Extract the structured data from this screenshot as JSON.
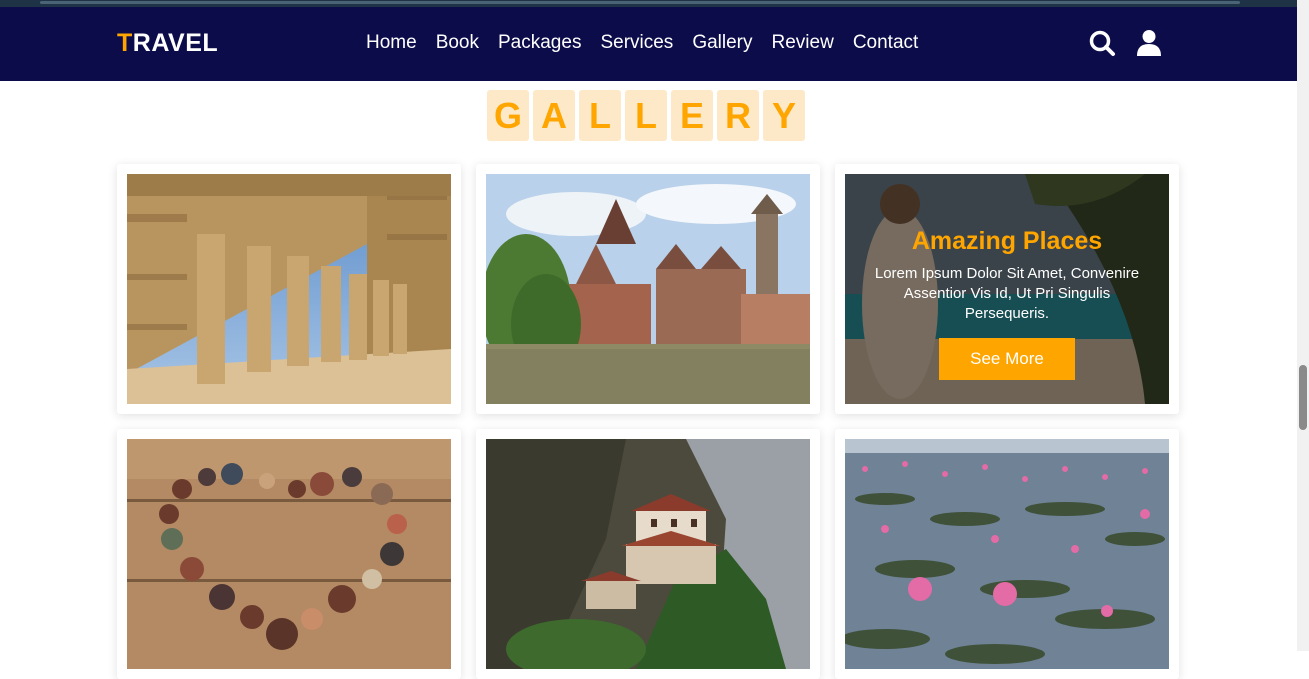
{
  "header": {
    "logo_first": "T",
    "logo_rest": "RAVEL",
    "nav": [
      "Home",
      "Book",
      "Packages",
      "Services",
      "Gallery",
      "Review",
      "Contact"
    ],
    "icons": [
      "search-icon",
      "user-icon"
    ]
  },
  "gallery": {
    "heading_letters": [
      "G",
      "A",
      "L",
      "L",
      "E",
      "R",
      "Y"
    ],
    "overlay": {
      "title": "Amazing Places",
      "text": "Lorem Ipsum Dolor Sit Amet, Convenire Assentior Vis Id, Ut Pri Singulis Persequeris.",
      "button": "See More"
    }
  },
  "colors": {
    "header_bg": "#0c0c4a",
    "accent": "#ffa500"
  }
}
